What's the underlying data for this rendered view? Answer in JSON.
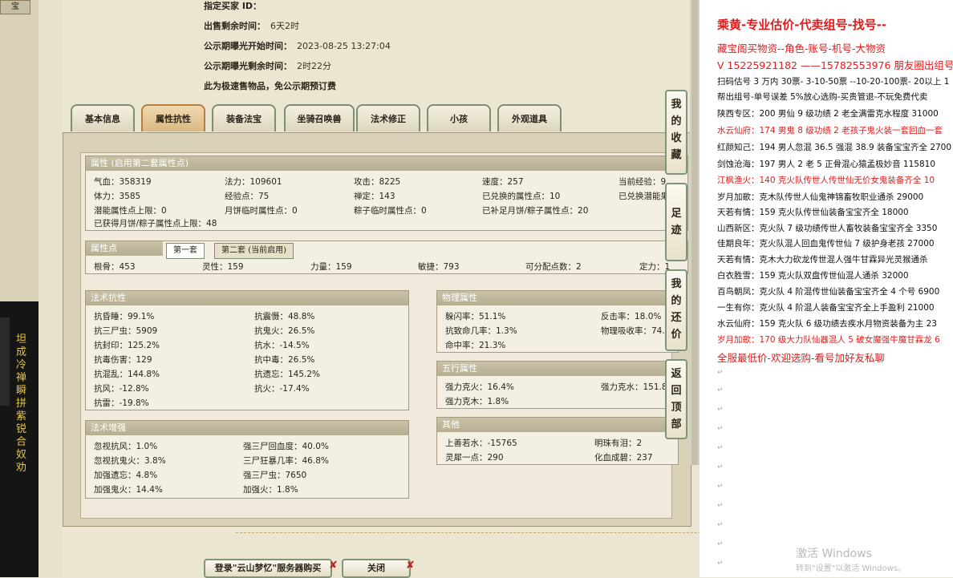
{
  "left": {
    "top_tab": "宝",
    "chars": "坦成冷禅瞬拼紫锐合奴劝"
  },
  "info": {
    "seller_label": "指定买家 ID：",
    "remaining_label": "出售剩余时间：",
    "remaining_value": "6天2时",
    "public_start_label": "公示期曝光开始时间：",
    "public_start_value": "2023-08-25 13:27:04",
    "public_remain_label": "公示期曝光剩余时间：",
    "public_remain_value": "2时22分",
    "note": "此为极速售物品，免公示期预订费"
  },
  "tabs": [
    "基本信息",
    "属性抗性",
    "装备法宝",
    "坐骑召唤兽",
    "法术修正",
    "小孩",
    "外观道具"
  ],
  "attr": {
    "header": "属性 (启用第二套属性点)",
    "rows": [
      [
        "气血：358319",
        "法力：109601",
        "攻击：8225",
        "速度：257",
        "当前经验：9..."
      ],
      [
        "体力：3585",
        "经验点：75",
        "禅定：143",
        "已兑换的属性点：10",
        "已兑换潜能果"
      ],
      [
        "潜能属性点上限：0",
        "月饼临时属性点：0",
        "粽子临时属性点：0",
        "已补足月饼/粽子属性点：20",
        ""
      ]
    ],
    "footer": "已获得月饼/粽子属性点上限：48"
  },
  "points": {
    "header": "属性点",
    "tab1": "第一套",
    "tab2": "第二套 (当前启用)",
    "cells": [
      "根骨：453",
      "灵性：159",
      "力量：159",
      "敏捷：793",
      "可分配点数：2",
      "定力：1"
    ]
  },
  "spell_resist": {
    "header": "法术抗性",
    "cells": [
      "抗昏睡：99.1%",
      "抗震慑：48.8%",
      "抗三尸虫：5909",
      "抗鬼火：26.5%",
      "抗封印：125.2%",
      "抗水：-14.5%",
      "抗毒伤害：129",
      "抗中毒：26.5%",
      "抗混乱：144.8%",
      "抗遗忘：145.2%",
      "抗风：-12.8%",
      "抗火：-17.4%",
      "抗雷：-19.8%"
    ]
  },
  "spell_boost": {
    "header": "法术增强",
    "cells": [
      "忽视抗风：1.0%",
      "强三尸回血度：40.0%",
      "忽视抗鬼火：3.8%",
      "三尸狂暴几率：46.8%",
      "加强遗忘：4.8%",
      "强三尸虫：7650",
      "加强鬼火：14.4%",
      "加强火：1.8%"
    ]
  },
  "physical": {
    "header": "物理属性",
    "cells": [
      "躲闪率：51.1%",
      "反击率：18.0%",
      "抗致命几率：1.3%",
      "物理吸收率：74.",
      "命中率：21.3%"
    ]
  },
  "five_elements": {
    "header": "五行属性",
    "cells": [
      "强力克火：16.4%",
      "强力克水：151.8",
      "强力克木：1.8%"
    ]
  },
  "other": {
    "header": "其他",
    "cells": [
      "上善若水：-15765",
      "明珠有泪：2",
      "灵犀一点：290",
      "化血成碧：237"
    ]
  },
  "side_buttons": [
    "我的收藏",
    "足迹",
    "我的还价",
    "返回顶部"
  ],
  "bottom": {
    "login_btn": "登录\"云山梦忆\"服务器购买",
    "close_btn": "关闭"
  },
  "doc": {
    "title": "乘黄-专业估价-代卖组号-找号--",
    "lines": [
      {
        "t": "藏宝阁买物资--角色-账号-机号-大物资",
        "c": "red",
        "big": true
      },
      {
        "t": "V 15225921182 ——15782553976 朋友圈出组号",
        "c": "red",
        "big": true
      },
      {
        "t": "扫码估号 3 万内 30票- 3-10-50票 --10-20-100票- 20以上 1",
        "c": "black"
      },
      {
        "t": "帮出组号-单号误差 5%放心选购-买贵管退-不玩免费代卖",
        "c": "black"
      },
      {
        "t": "陕西专区：200 男仙 9 级功绩 2 老全满雷克水程度 31000",
        "c": "black"
      },
      {
        "t": "水云仙府：174 男鬼 8 级功绩 2 老孩子鬼火装一套回血一套",
        "c": "red"
      },
      {
        "t": "红颜知己：194 男人忽混 36.5 强混 38.9 装备宝宝齐全 2700",
        "c": "black"
      },
      {
        "t": "剑蚀沧海：197 男人 2 老 5 正骨混心猿孟极妙音 115810",
        "c": "black"
      },
      {
        "t": "江枫渔火：140 克火队传世人传世仙无价女鬼装备齐全 10",
        "c": "red"
      },
      {
        "t": "岁月加歌：克木队传世人仙鬼神锦畜牧职业通杀 29000",
        "c": "black"
      },
      {
        "t": "天若有情：159 克火队传世仙装备宝宝齐全 18000",
        "c": "black"
      },
      {
        "t": "山西新区：克火队 7 级功绩传世人畜牧装备宝宝齐全 3350",
        "c": "black"
      },
      {
        "t": "佳期良年：克火队混人回血鬼传世仙 7 级护身老孩 27000",
        "c": "black"
      },
      {
        "t": "天若有情：克木大力砍龙传世混人强牛甘霖异光灵猴通杀",
        "c": "black"
      },
      {
        "t": "白衣胜雪：159 克火队双盘传世仙混人通杀 32000",
        "c": "black"
      },
      {
        "t": "百鸟朝凤：克火队 4 阶混传世仙装备宝宝齐全 4 个号 6900",
        "c": "black"
      },
      {
        "t": "一生有你：克火队 4 阶混人装备宝宝齐全上手盈利 21000",
        "c": "black"
      },
      {
        "t": "水云仙府：159 克火队 6 级功绩去疾水月物资装备为主 23",
        "c": "black"
      },
      {
        "t": "岁月加歌：170 级大力队仙器混人 5 破女魔强牛魔甘霖龙 6",
        "c": "red"
      },
      {
        "t": "全服最低价-欢迎选购-看号加好友私聊",
        "c": "red",
        "big": true
      }
    ]
  },
  "watermark": {
    "line1": "激活 Windows",
    "line2": "转到\"设置\"以激活 Windows。"
  }
}
